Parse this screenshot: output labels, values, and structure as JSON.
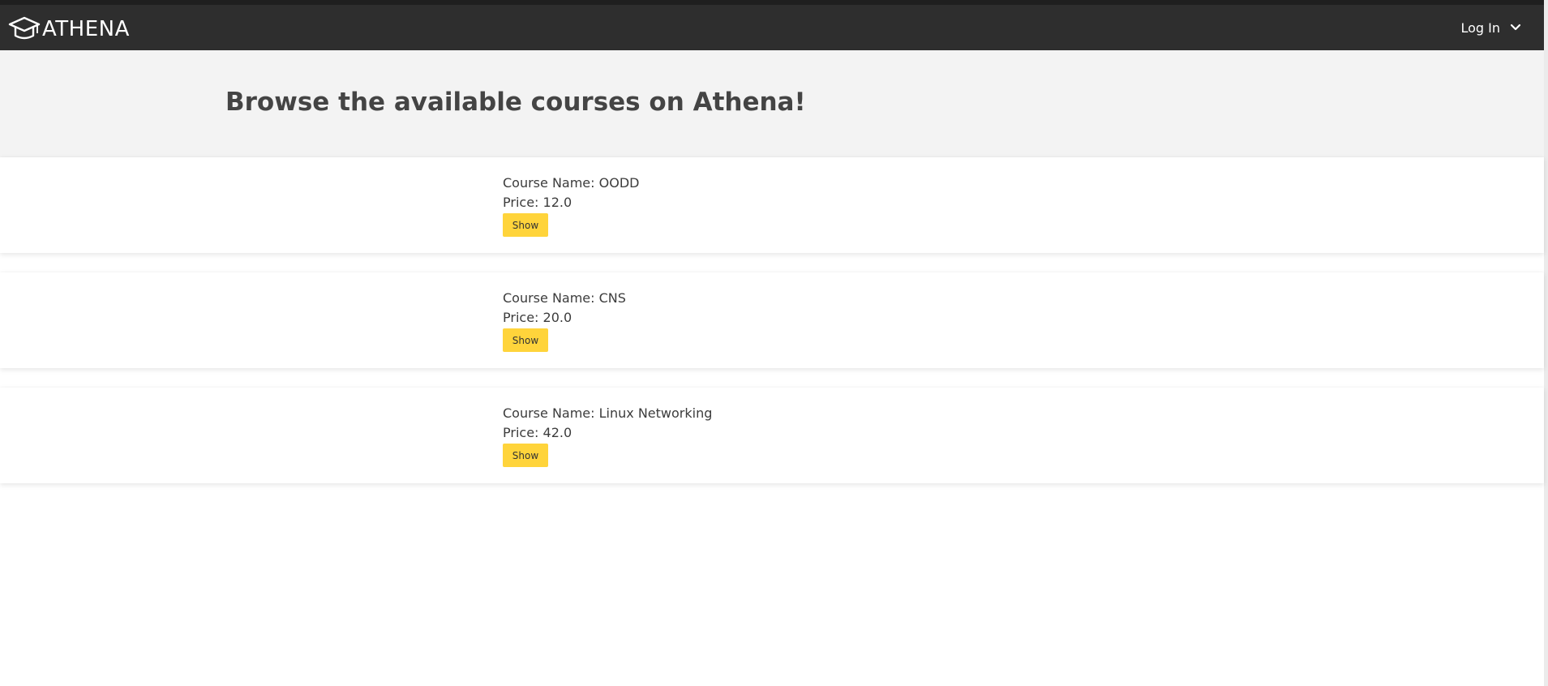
{
  "navbar": {
    "brand": "ATHENA",
    "login_label": "Log In"
  },
  "hero": {
    "title": "Browse the available courses on Athena!"
  },
  "courses": [
    {
      "name_line": "Course Name: OODD",
      "price_line": "Price: 12.0",
      "button": "Show"
    },
    {
      "name_line": "Course Name: CNS",
      "price_line": "Price: 20.0",
      "button": "Show"
    },
    {
      "name_line": "Course Name: Linux Networking",
      "price_line": "Price: 42.0",
      "button": "Show"
    }
  ],
  "colors": {
    "navbar": "#2e2e2e",
    "hero": "#f3f3f3",
    "button": "#ffd43b"
  }
}
